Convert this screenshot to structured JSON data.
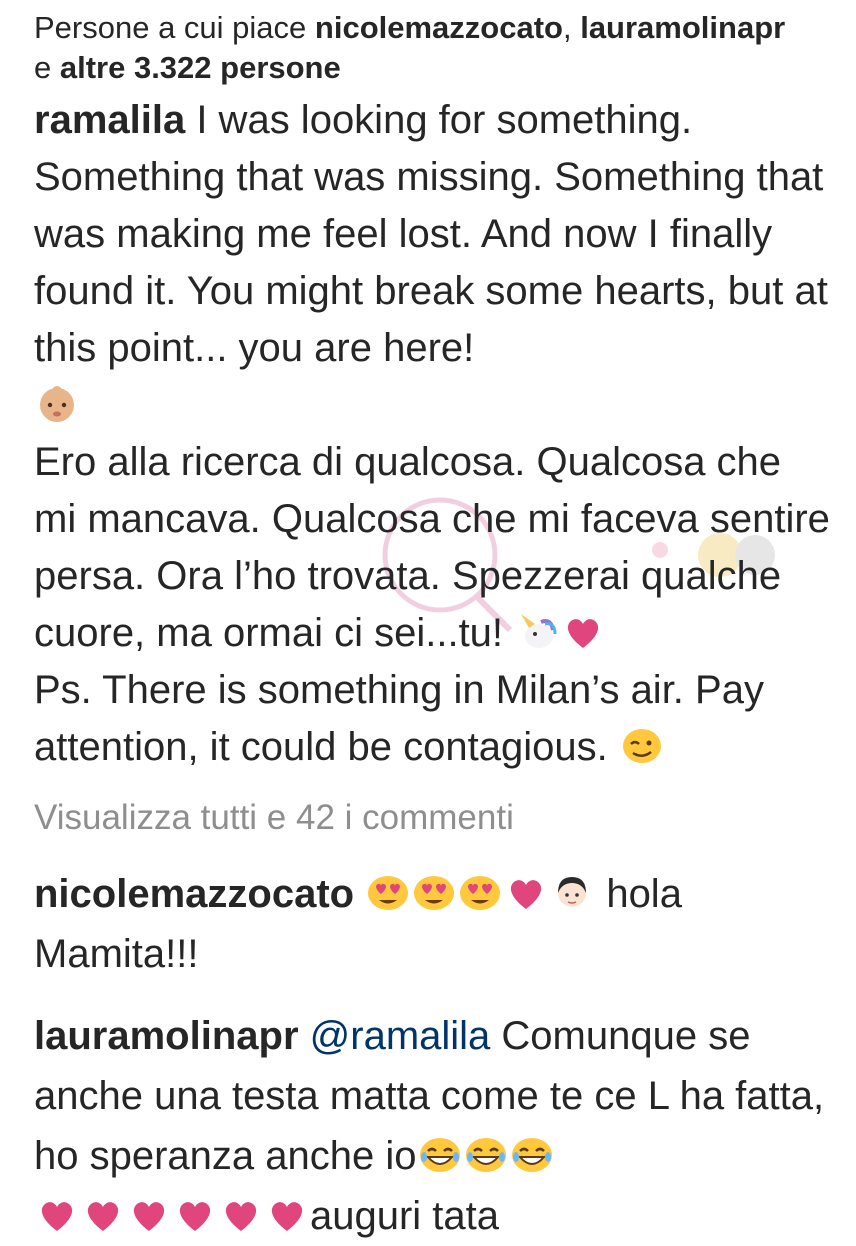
{
  "likes": {
    "prefix": "Persone a cui piace ",
    "user1": "nicolemazzocato",
    "separator": ", ",
    "user2": "lauramolinapr",
    "mid": "e ",
    "others": "altre 3.322 persone"
  },
  "caption": {
    "username": "ramalila",
    "text_en": " I was looking for something. Something that was missing. Something that was making me feel lost. And now I finally found it. You might break some hearts, but at this point... you are here!",
    "text_it": "Ero alla ricerca di qualcosa. Qualcosa che mi mancava. Qualcosa che mi faceva sentire persa. Ora l’ho trovata. Spezzerai qualche cuore, ma ormai ci sei...tu!",
    "text_ps": "Ps. There is something in Milan’s air. Pay attention, it could be contagious."
  },
  "view_all_comments": "Visualizza tutti e 42 i commenti",
  "comments": [
    {
      "username": "nicolemazzocato",
      "text": " hola Mamita!!!"
    },
    {
      "username": "lauramolinapr",
      "mention": "@ramalila",
      "text_a": " Comunque se anche una testa matta come te ce L ha fatta, ho speranza anche io",
      "text_b": "auguri tata"
    }
  ],
  "colors": {
    "text": "#262626",
    "muted": "#8e8e8e",
    "mention": "#003569",
    "heart": "#e0457b",
    "emoji_yellow": "#ffc83d"
  },
  "icons": [
    "baby-emoji-icon",
    "unicorn-emoji-icon",
    "heart-emoji-icon",
    "wink-emoji-icon",
    "heart-eyes-emoji-icon",
    "girl-emoji-icon",
    "laughing-emoji-icon"
  ]
}
